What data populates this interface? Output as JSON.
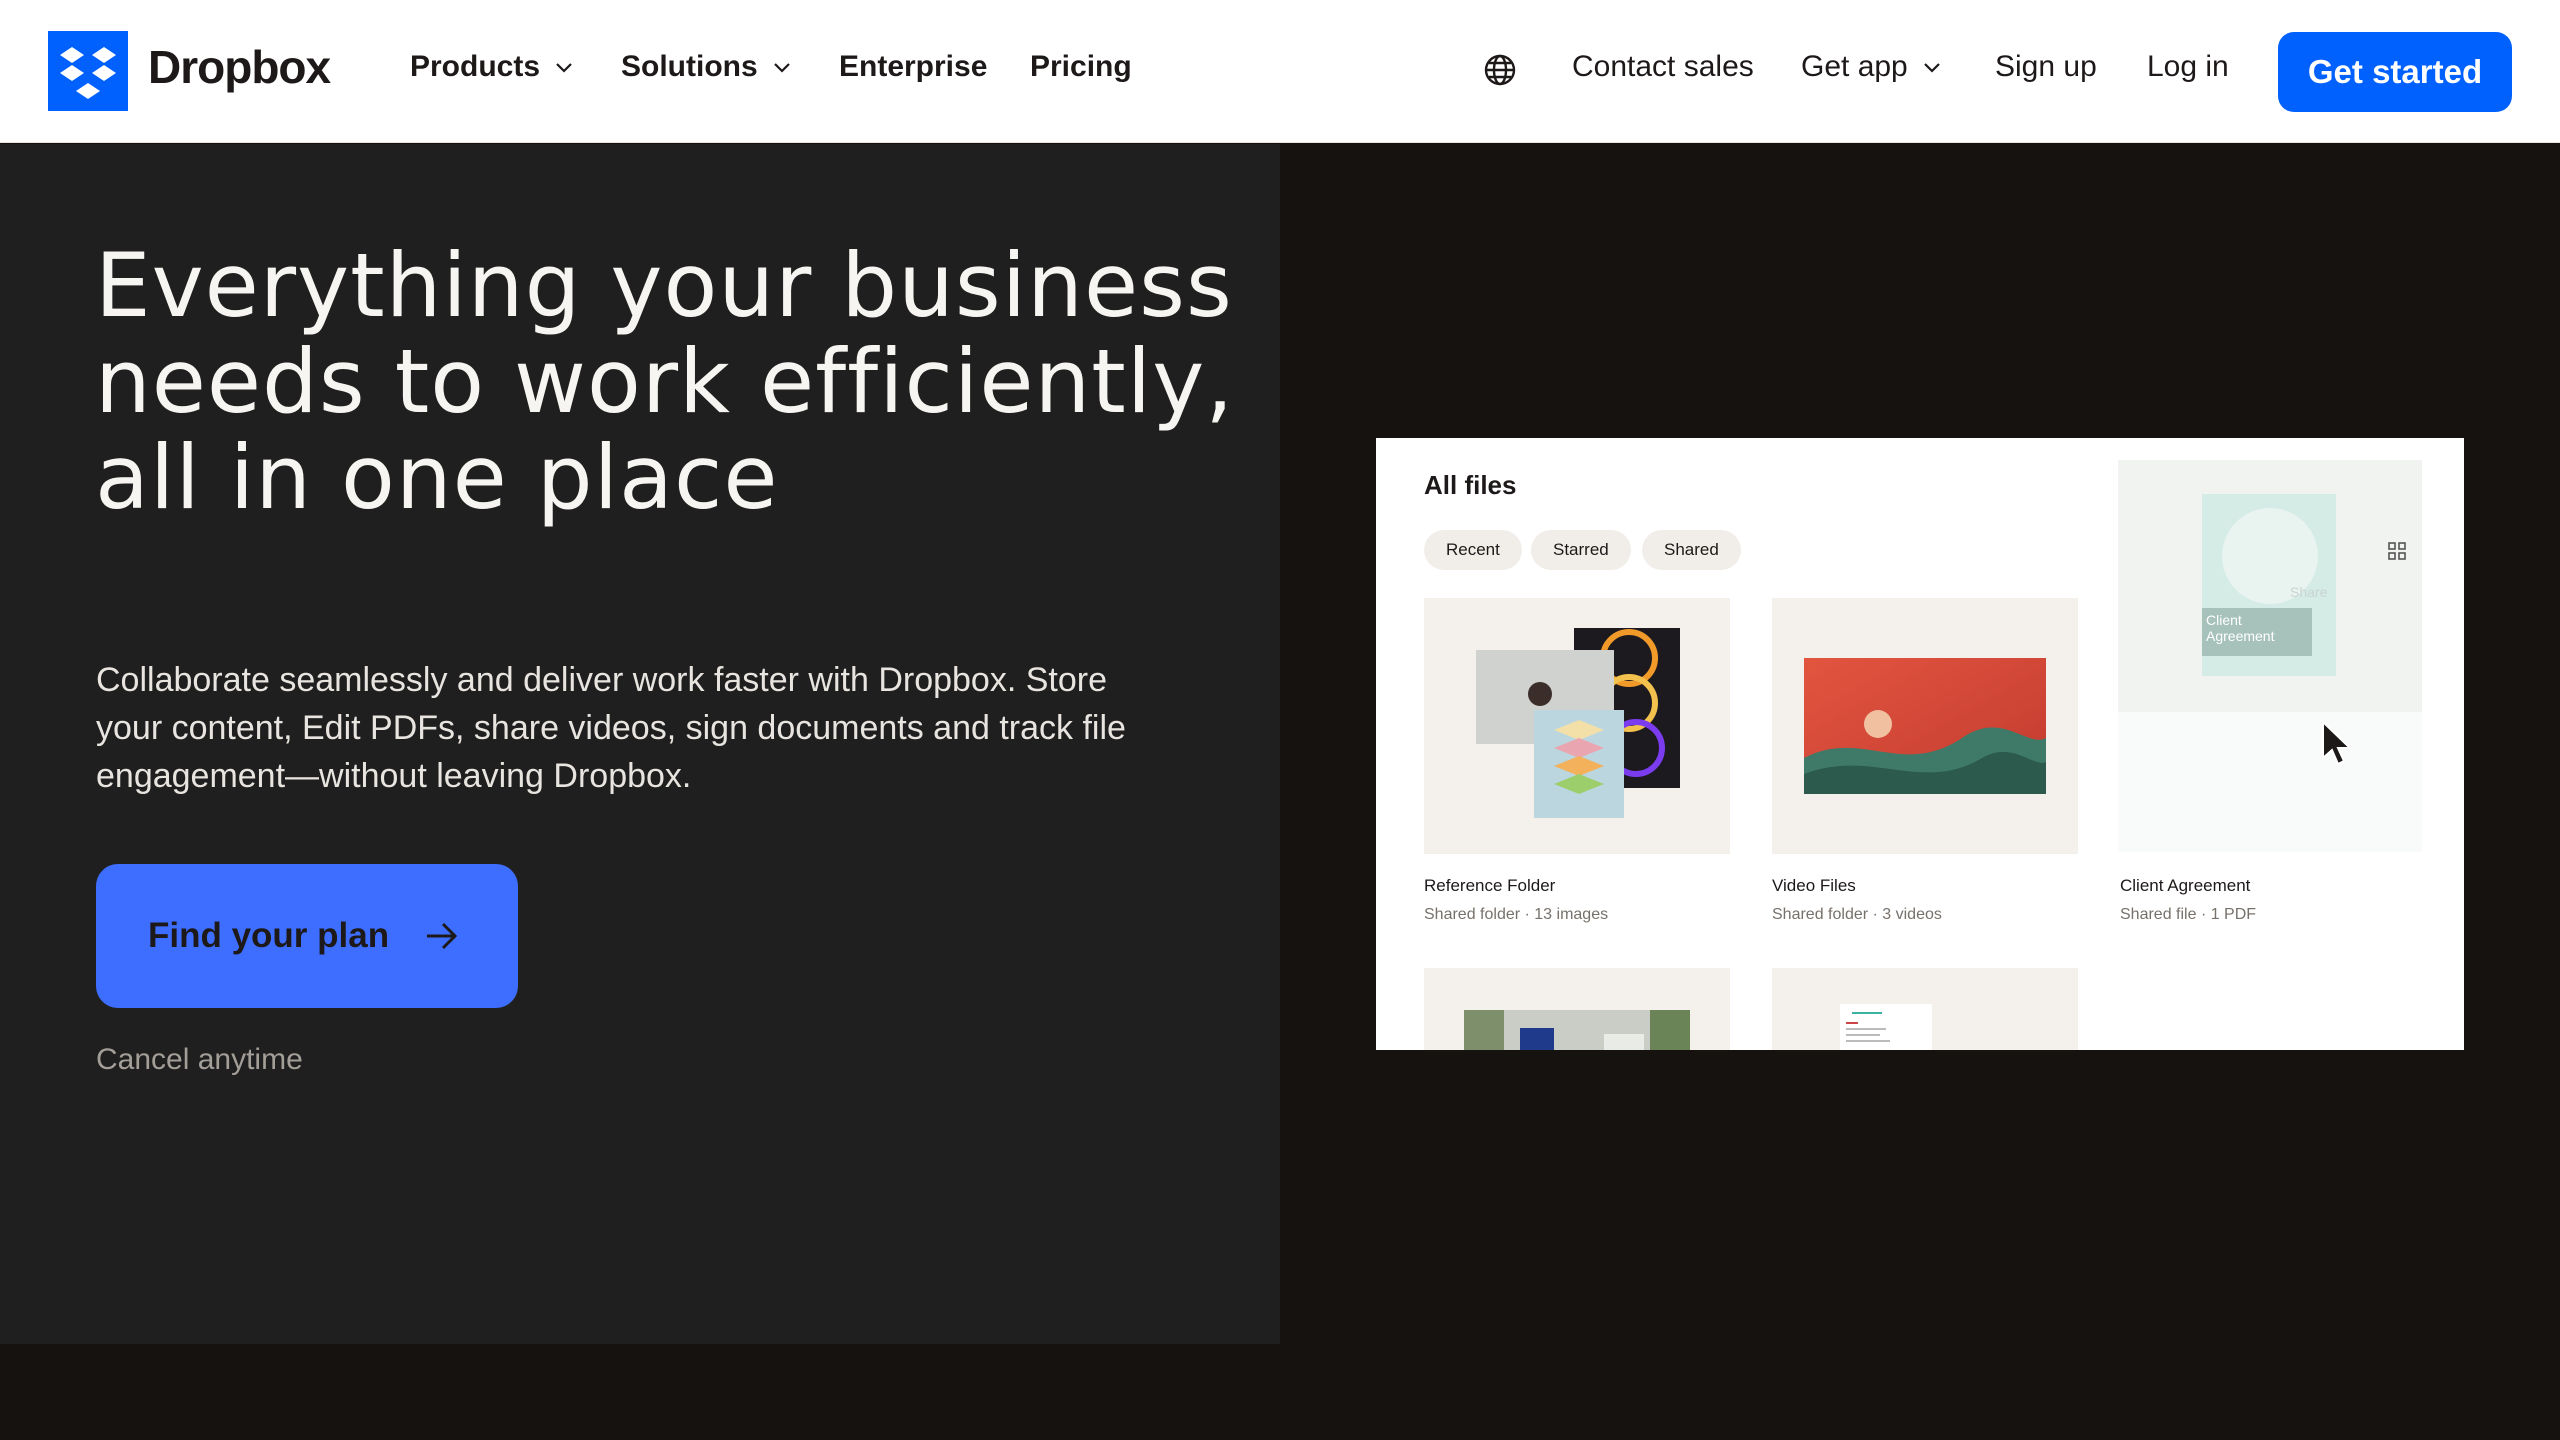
{
  "nav": {
    "brand": "Dropbox",
    "items": [
      {
        "label": "Products"
      },
      {
        "label": "Solutions"
      },
      {
        "label": "Enterprise"
      },
      {
        "label": "Pricing"
      }
    ],
    "right": {
      "contact": "Contact sales",
      "get_app": "Get app",
      "sign_up": "Sign up",
      "log_in": "Log in",
      "get_started": "Get started"
    }
  },
  "hero": {
    "headline": "Everything your business needs to work efficiently, all in one place",
    "subtext": "Collaborate seamlessly and deliver work faster with Dropbox. Store your content, Edit PDFs, share videos, sign documents and track file engagement—without leaving Dropbox.",
    "cta": "Find your plan",
    "note": "Cancel anytime"
  },
  "product": {
    "title": "All files",
    "filters": [
      "Recent",
      "Starred",
      "Shared"
    ],
    "cards": [
      {
        "name": "Reference Folder",
        "meta": "Shared folder · 13 images"
      },
      {
        "name": "Video Files",
        "meta": "Shared folder · 3 videos"
      },
      {
        "name": "Client Agreement",
        "meta": "Shared file · 1 PDF"
      }
    ],
    "overlay_label": "Client Agreement",
    "overlay_share": "Share"
  },
  "colors": {
    "brand_blue": "#0061fe",
    "cta_blue": "#3d6eff",
    "hero_left_bg": "#1f1f1f",
    "hero_right_bg": "#16120f"
  }
}
